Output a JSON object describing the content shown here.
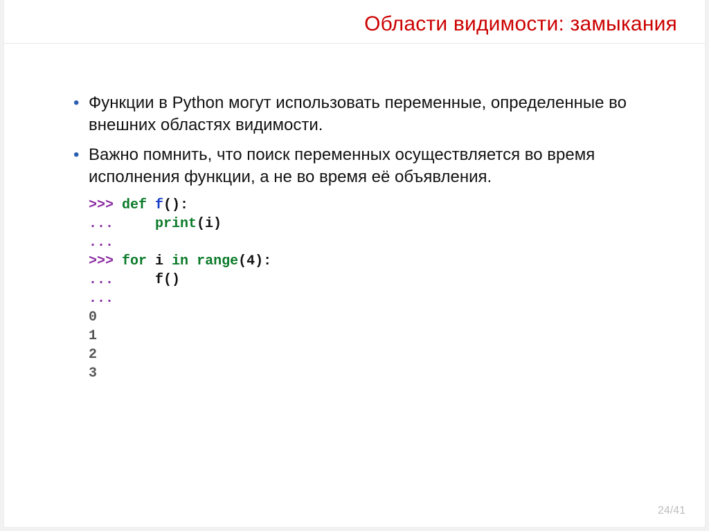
{
  "title": "Области видимости: замыкания",
  "bullets": [
    "Функции в Python могут использовать переменные, определенные во внешних областях видимости.",
    "Важно помнить, что поиск переменных осуществляется во время исполнения функции, а не во время её объявления."
  ],
  "code": {
    "l1": {
      "prompt": ">>> ",
      "kw": "def ",
      "fn": "f",
      "rest": "():"
    },
    "l2": {
      "prompt": "...     ",
      "builtin": "print",
      "rest": "(i)"
    },
    "l3": {
      "prompt": "..."
    },
    "l4": {
      "prompt": ">>> ",
      "kw1": "for ",
      "id": "i ",
      "kw2": "in ",
      "builtin": "range",
      "rest": "(4):"
    },
    "l5": {
      "prompt": "...     ",
      "call": "f()"
    },
    "l6": {
      "prompt": "..."
    },
    "out": [
      "0",
      "1",
      "2",
      "3"
    ]
  },
  "pager": "24/41"
}
